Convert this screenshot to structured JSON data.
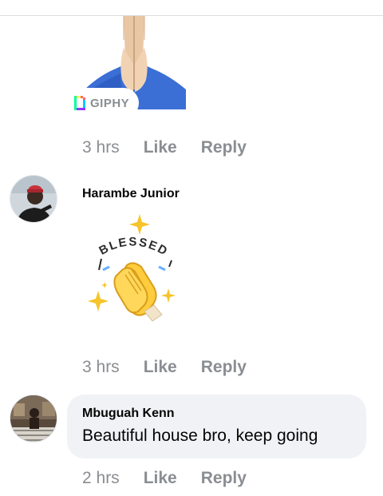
{
  "gif": {
    "provider_label": "GIPHY",
    "icon": "praying-hands-gif"
  },
  "comments": [
    {
      "time": "3 hrs",
      "like_label": "Like",
      "reply_label": "Reply"
    },
    {
      "author": "Harambe Junior",
      "sticker_text": "BLESSED",
      "time": "3 hrs",
      "like_label": "Like",
      "reply_label": "Reply"
    },
    {
      "author": "Mbuguah Kenn",
      "text": "Beautiful house bro, keep going",
      "time": "2 hrs",
      "like_label": "Like",
      "reply_label": "Reply"
    }
  ],
  "colors": {
    "meta_text": "#8a8d91",
    "bubble_bg": "#f0f2f5",
    "name_text": "#050505",
    "gif_blue": "#3b6fd6",
    "hand_skin": "#e9c7a4"
  }
}
